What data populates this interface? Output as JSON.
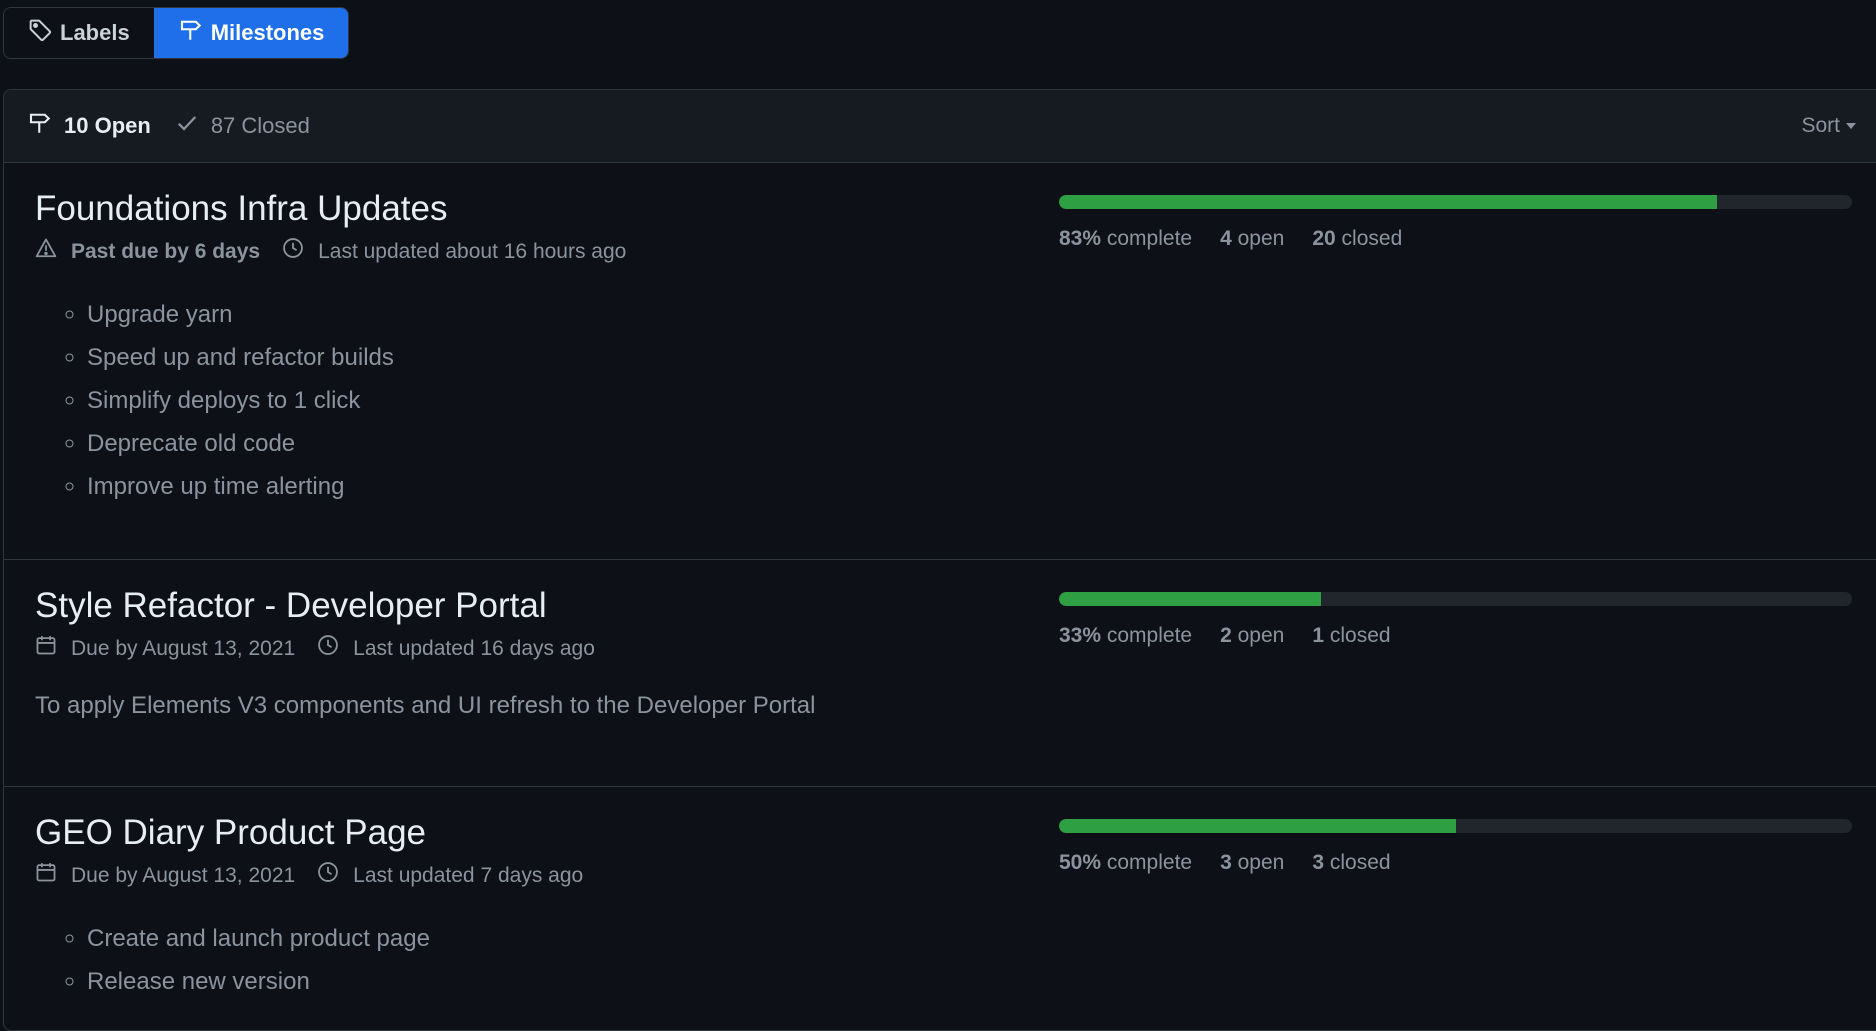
{
  "subnav": {
    "labels": "Labels",
    "milestones": "Milestones"
  },
  "header": {
    "open_count": "10 Open",
    "closed_count": "87 Closed",
    "sort_label": "Sort"
  },
  "colors": {
    "background": "#0d1117",
    "selected_tab": "#1f6feb",
    "progress_fill": "#2ea043",
    "progress_track": "#21262d"
  },
  "milestones": [
    {
      "title": "Foundations Infra Updates",
      "due_text": "Past due by 6 days",
      "due_icon": "alert-icon",
      "updated_text": "Last updated about 16 hours ago",
      "progress_fraction": 0.83,
      "percent": "83%",
      "complete_label": "complete",
      "open_count": "4",
      "open_label": "open",
      "closed_count": "20",
      "closed_label": "closed",
      "description_items": [
        "Upgrade yarn",
        "Speed up and refactor builds",
        "Simplify deploys to 1 click",
        "Deprecate old code",
        "Improve up time alerting"
      ]
    },
    {
      "title": "Style Refactor - Developer Portal",
      "due_text": "Due by August 13, 2021",
      "due_icon": "calendar-icon",
      "updated_text": "Last updated 16 days ago",
      "progress_fraction": 0.33,
      "percent": "33%",
      "complete_label": "complete",
      "open_count": "2",
      "open_label": "open",
      "closed_count": "1",
      "closed_label": "closed",
      "description_text": "To apply Elements V3 components and UI refresh to the Developer Portal"
    },
    {
      "title": "GEO Diary Product Page",
      "due_text": "Due by August 13, 2021",
      "due_icon": "calendar-icon",
      "updated_text": "Last updated 7 days ago",
      "progress_fraction": 0.5,
      "percent": "50%",
      "complete_label": "complete",
      "open_count": "3",
      "open_label": "open",
      "closed_count": "3",
      "closed_label": "closed",
      "description_items": [
        "Create and launch product page",
        "Release new version"
      ]
    }
  ]
}
